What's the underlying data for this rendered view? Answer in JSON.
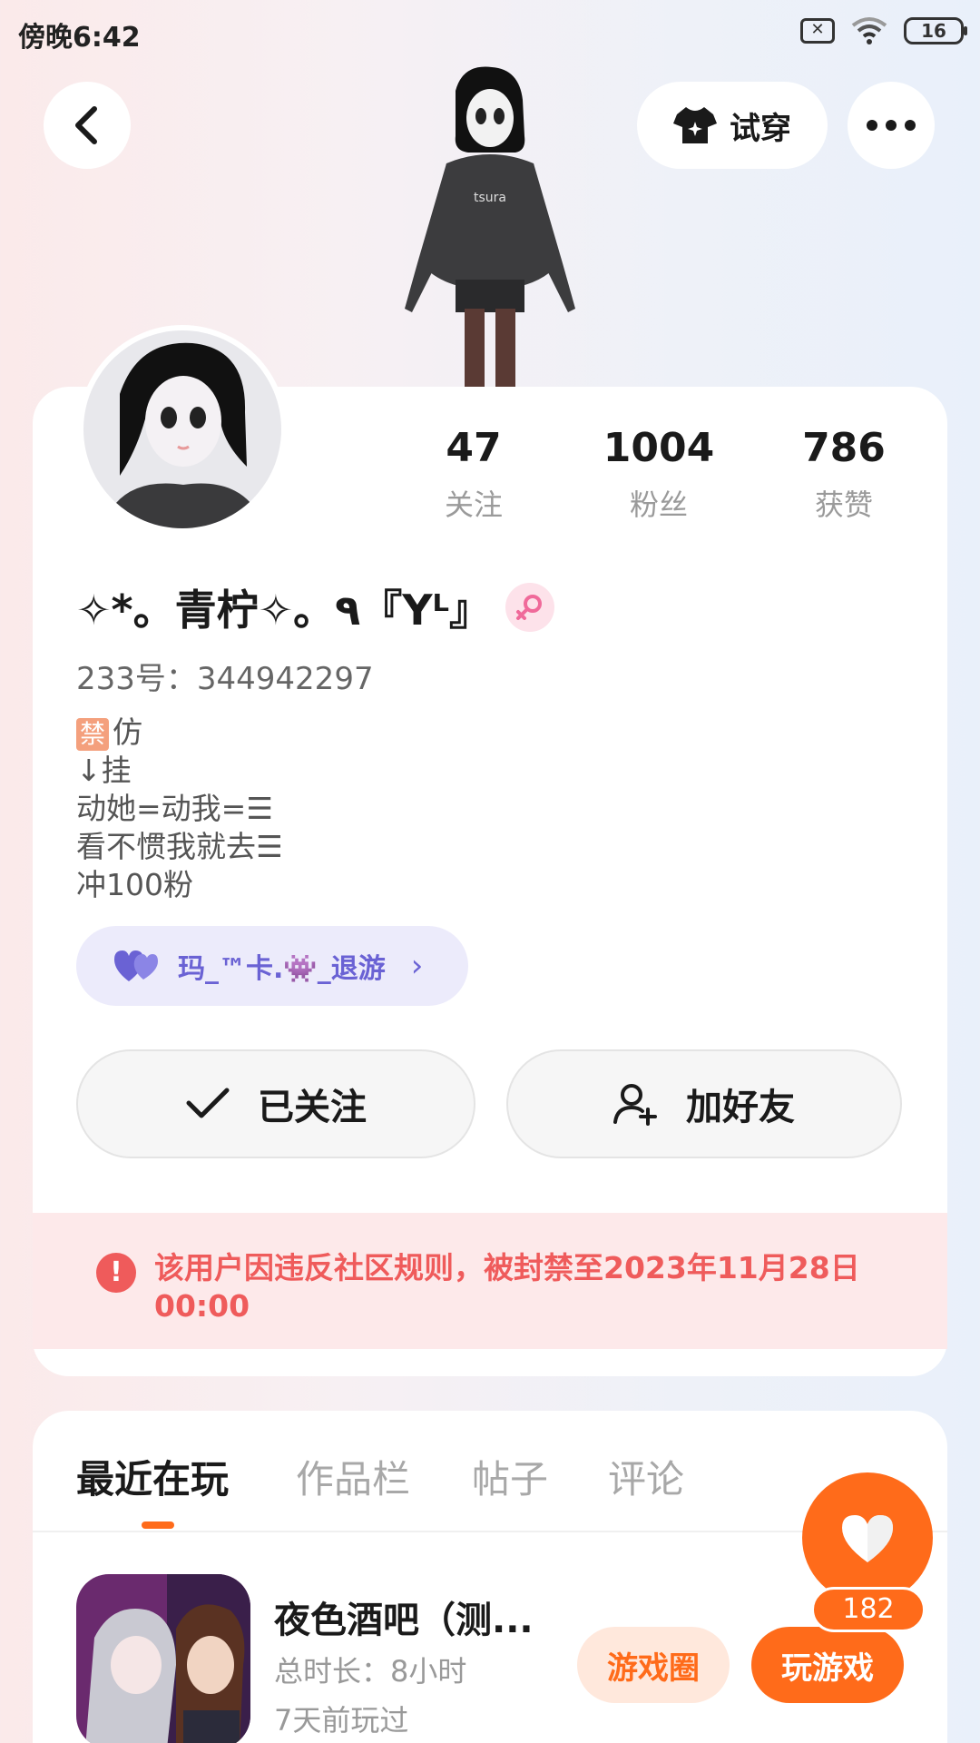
{
  "status_bar": {
    "time": "傍晚6:42",
    "battery": "16"
  },
  "header": {
    "tryon_label": "试穿"
  },
  "profile": {
    "stats": [
      {
        "value": "47",
        "label": "关注"
      },
      {
        "value": "1004",
        "label": "粉丝"
      },
      {
        "value": "786",
        "label": "获赞"
      }
    ],
    "nickname": "✧*。青柠✧。٩『Yᴸ』",
    "user_id": "233号：344942297",
    "bio": {
      "ban_tag": "禁",
      "line1": "仿",
      "line2": "↓挂",
      "line3": "动她=动我=☰",
      "line4": "看不惯我就去☰",
      "line5": "冲100粉"
    },
    "cp_chip": "玛_™卡.👾_退游",
    "followed_button": "已关注",
    "add_friend_button": "加好友",
    "ban_notice": "该用户因违反社区规则，被封禁至2023年11月28日 00:00"
  },
  "tabs": [
    "最近在玩",
    "作品栏",
    "帖子",
    "评论"
  ],
  "game": {
    "title": "夜色酒吧（测...",
    "duration": "总时长：8小时",
    "last_played": "7天前玩过",
    "circle_button": "游戏圈",
    "play_button": "玩游戏"
  },
  "like": {
    "count": "182"
  },
  "colors": {
    "accent": "#ff6b1a",
    "ban_red": "#ef5b5b",
    "cp_purple": "#6a62d4"
  }
}
